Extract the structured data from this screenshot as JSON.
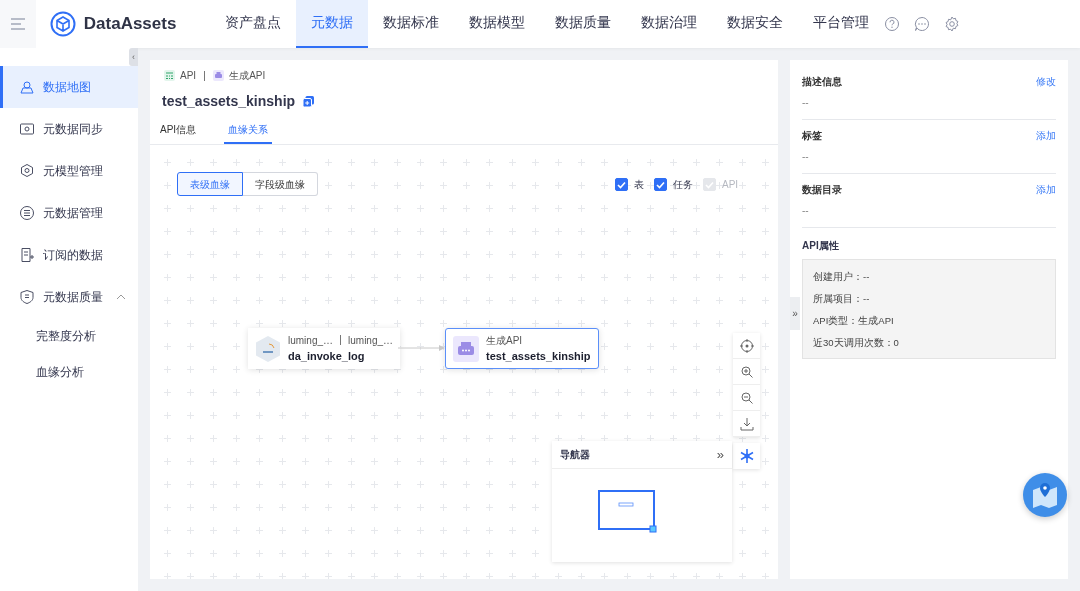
{
  "header": {
    "brand": "DataAssets",
    "nav": [
      {
        "label": "资产盘点",
        "selected": false
      },
      {
        "label": "元数据",
        "selected": true
      },
      {
        "label": "数据标准",
        "selected": false
      },
      {
        "label": "数据模型",
        "selected": false
      },
      {
        "label": "数据质量",
        "selected": false
      },
      {
        "label": "数据治理",
        "selected": false
      },
      {
        "label": "数据安全",
        "selected": false
      },
      {
        "label": "平台管理",
        "selected": false
      }
    ]
  },
  "sidebar": {
    "collapse": "‹",
    "items": [
      {
        "label": "数据地图",
        "selected": true
      },
      {
        "label": "元数据同步",
        "selected": false
      },
      {
        "label": "元模型管理",
        "selected": false
      },
      {
        "label": "元数据管理",
        "selected": false
      },
      {
        "label": "订阅的数据",
        "selected": false
      },
      {
        "label": "元数据质量",
        "selected": false,
        "expanded": true,
        "children": [
          {
            "label": "完整度分析",
            "selected": false
          },
          {
            "label": "血缘分析",
            "selected": false
          }
        ]
      }
    ]
  },
  "breadcrumb": [
    {
      "kind": "api",
      "label": "API"
    },
    {
      "kind": "generated",
      "label": "生成API"
    }
  ],
  "title": "test_assets_kinship",
  "tabs": [
    {
      "label": "API信息",
      "selected": false
    },
    {
      "label": "血缘关系",
      "selected": true
    }
  ],
  "lineage_modes": [
    {
      "label": "表级血缘",
      "selected": true
    },
    {
      "label": "字段级血缘",
      "selected": false
    }
  ],
  "filters": [
    {
      "label": "表",
      "checked": true,
      "disabled": false
    },
    {
      "label": "任务",
      "checked": true,
      "disabled": false
    },
    {
      "label": "API",
      "checked": true,
      "disabled": true
    }
  ],
  "nodes": [
    {
      "kind": "table",
      "meta": [
        "luming_…",
        "luming_…"
      ],
      "name": "da_invoke_log",
      "selected": false
    },
    {
      "kind": "api",
      "meta": [
        "生成API"
      ],
      "name": "test_assets_kinship",
      "selected": true
    }
  ],
  "navigator": {
    "title": "导航器",
    "collapse": "»"
  },
  "panel_handle": "»",
  "right_panel": {
    "sections": [
      {
        "title": "描述信息",
        "action": "修改",
        "value": "--"
      },
      {
        "title": "标签",
        "action": "添加",
        "value": "--"
      },
      {
        "title": "数据目录",
        "action": "添加",
        "value": "--"
      }
    ],
    "properties_title": "API属性",
    "properties": [
      {
        "label": "创建用户：",
        "value": "--"
      },
      {
        "label": "所属项目：",
        "value": "--"
      },
      {
        "label": "API类型：",
        "value": "生成API"
      },
      {
        "label": "近30天调用次数：",
        "value": "0"
      }
    ]
  }
}
